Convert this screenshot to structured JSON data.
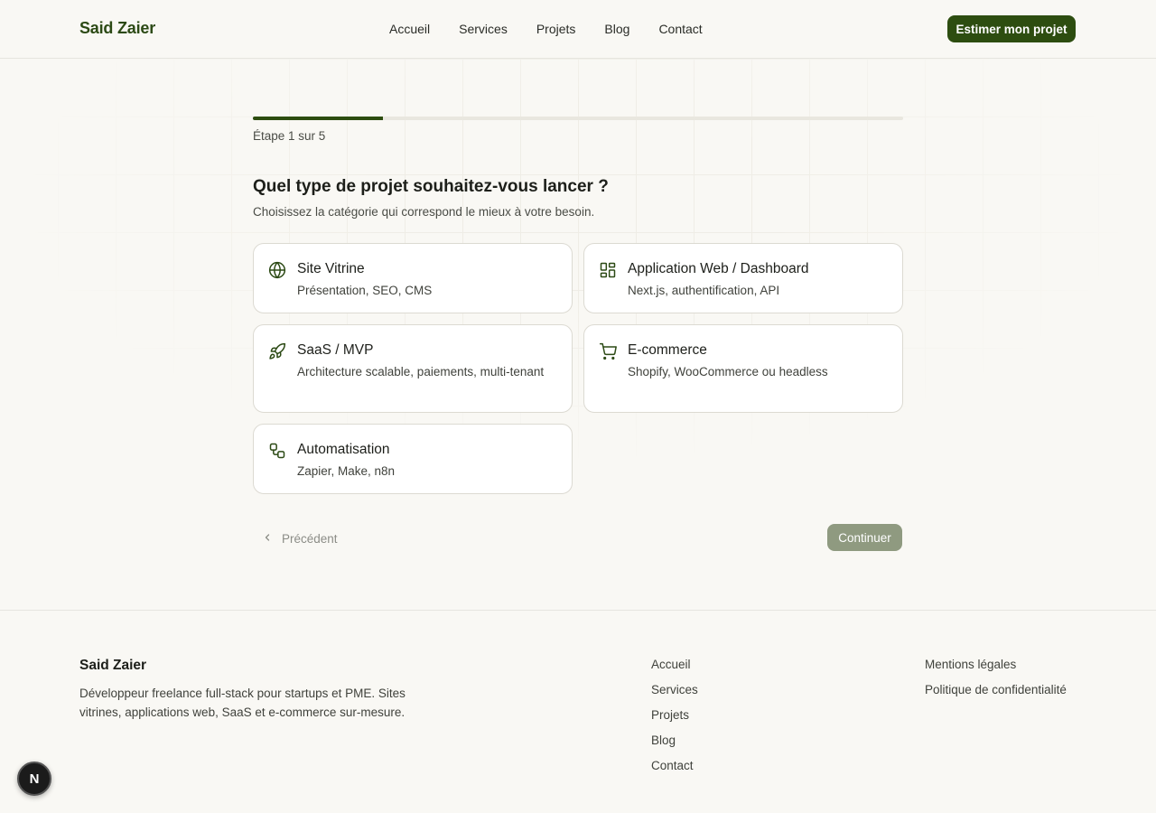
{
  "header": {
    "logo": "Said Zaier",
    "nav": [
      "Accueil",
      "Services",
      "Projets",
      "Blog",
      "Contact"
    ],
    "cta": "Estimer mon projet"
  },
  "wizard": {
    "progress": 0.2,
    "step_label": "Étape 1 sur 5",
    "title": "Quel type de projet souhaitez-vous lancer ?",
    "subtitle": "Choisissez la catégorie qui correspond le mieux à votre besoin.",
    "options": [
      {
        "title": "Site Vitrine",
        "desc": "Présentation, SEO, CMS",
        "icon": "globe-icon"
      },
      {
        "title": "Application Web / Dashboard",
        "desc": "Next.js, authentification, API",
        "icon": "dashboard-icon"
      },
      {
        "title": "SaaS / MVP",
        "desc": "Architecture scalable, paiements, multi-tenant",
        "icon": "rocket-icon"
      },
      {
        "title": "E-commerce",
        "desc": "Shopify, WooCommerce ou headless",
        "icon": "cart-icon"
      },
      {
        "title": "Automatisation",
        "desc": "Zapier, Make, n8n",
        "icon": "workflow-icon"
      }
    ],
    "prev_label": "Précédent",
    "next_label": "Continuer"
  },
  "footer": {
    "brand": "Said Zaier",
    "description": "Développeur freelance full-stack pour startups et PME. Sites vitrines, applications web, SaaS et e-commerce sur-mesure.",
    "links": [
      "Accueil",
      "Services",
      "Projets",
      "Blog",
      "Contact"
    ],
    "legal": [
      "Mentions légales",
      "Politique de confidentialité"
    ]
  },
  "dev_badge": {
    "letter": "N"
  },
  "colors": {
    "accent": "#2d4d10",
    "disabled": "#8f9a80",
    "background": "#f9f8f4"
  }
}
